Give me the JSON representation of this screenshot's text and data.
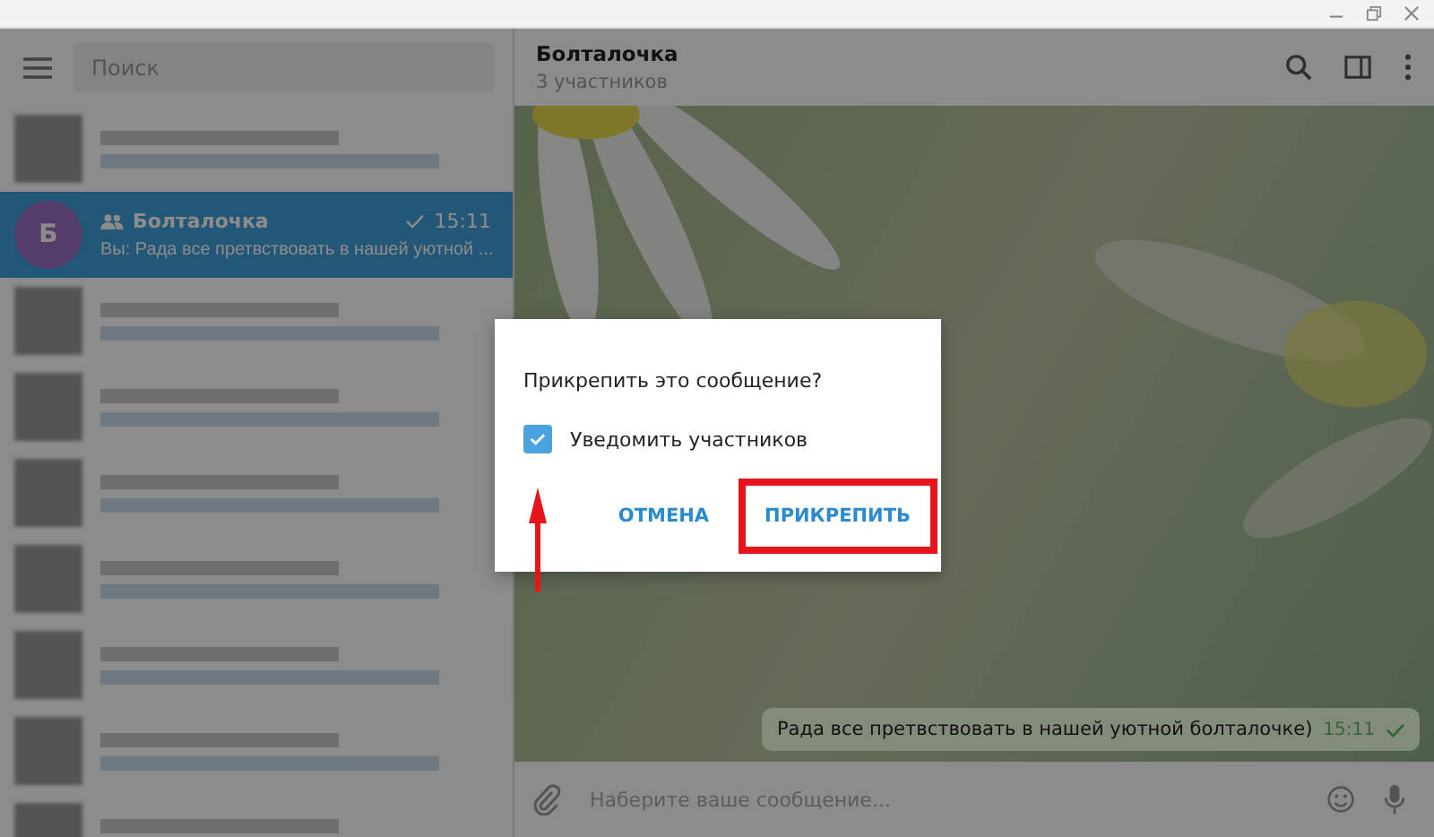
{
  "sidebar": {
    "search": {
      "placeholder": "Поиск"
    },
    "chats": [
      {
        "kind": "pixelated",
        "selected": false
      },
      {
        "kind": "chat",
        "selected": true,
        "avatar_letter": "Б",
        "name": "Болталочка",
        "time": "15:11",
        "read": true,
        "preview": "Вы: Рада все претвствовать в нашей уютной ..."
      },
      {
        "kind": "pixelated",
        "selected": false
      },
      {
        "kind": "pixelated",
        "selected": false
      },
      {
        "kind": "pixelated",
        "selected": false
      },
      {
        "kind": "pixelated",
        "selected": false
      },
      {
        "kind": "pixelated",
        "selected": false
      },
      {
        "kind": "pixelated",
        "selected": false
      },
      {
        "kind": "pixelated",
        "selected": false
      }
    ]
  },
  "chat": {
    "title": "Болталочка",
    "subtitle": "3 участников",
    "messages": [
      {
        "text": "Рада все претвствовать в нашей уютной болталочке)",
        "time": "15:11",
        "read": true
      }
    ],
    "input": {
      "placeholder": "Наберите ваше сообщение..."
    }
  },
  "dialog": {
    "question": "Прикрепить это сообщение?",
    "checkbox": {
      "label": "Уведомить участников",
      "checked": true
    },
    "buttons": [
      {
        "label": "ОТМЕНА",
        "highlighted": false
      },
      {
        "label": "ПРИКРЕПИТЬ",
        "highlighted": true
      }
    ],
    "annotation_arrow": true
  }
}
